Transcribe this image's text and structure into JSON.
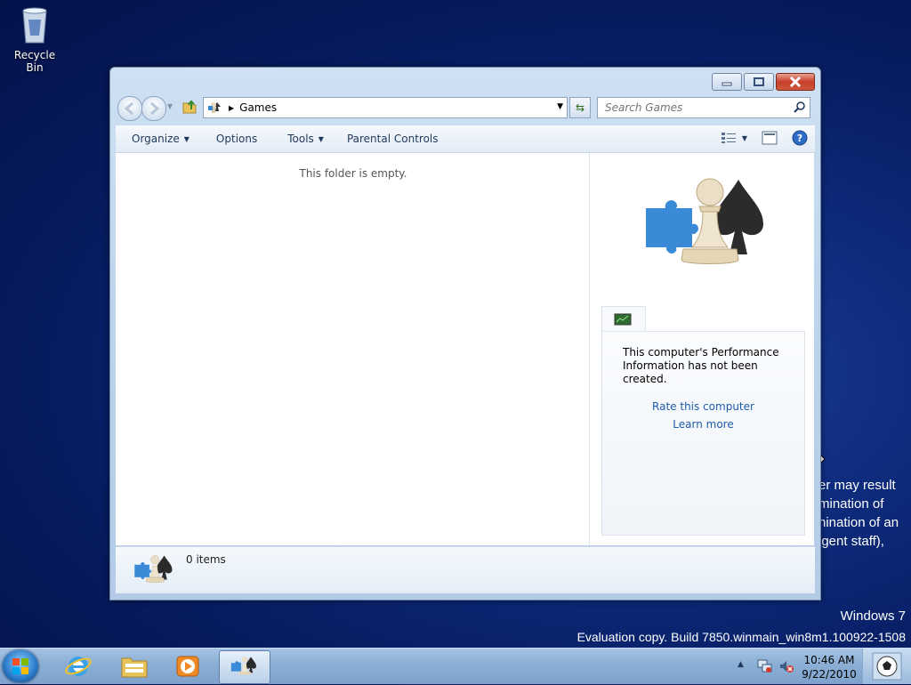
{
  "desktop": {
    "recycle_bin_label": "Recycle Bin",
    "background_text_lines": [
      "er may result",
      "mination of",
      "nination of an",
      "igent staff),"
    ],
    "watermark_line1": "Windows 7",
    "watermark_line2": "Evaluation copy. Build 7850.winmain_win8m1.100922-1508"
  },
  "window": {
    "address_crumb": "Games",
    "search_placeholder": "Search Games",
    "commands": [
      {
        "label": "Organize",
        "dropdown": true
      },
      {
        "label": "Options",
        "dropdown": false
      },
      {
        "label": "Tools",
        "dropdown": true
      },
      {
        "label": "Parental Controls",
        "dropdown": false
      }
    ],
    "empty_message": "This folder is empty.",
    "performance_message": "This computer's Performance Information has not been created.",
    "rate_link": "Rate this computer",
    "learn_link": "Learn more",
    "status_count": "0 items"
  },
  "taskbar": {
    "time": "10:46 AM",
    "date": "9/22/2010"
  },
  "colors": {
    "desktop": "#0d2a7a",
    "link": "#1e5aa8",
    "taskbar": "#8aaed4"
  }
}
